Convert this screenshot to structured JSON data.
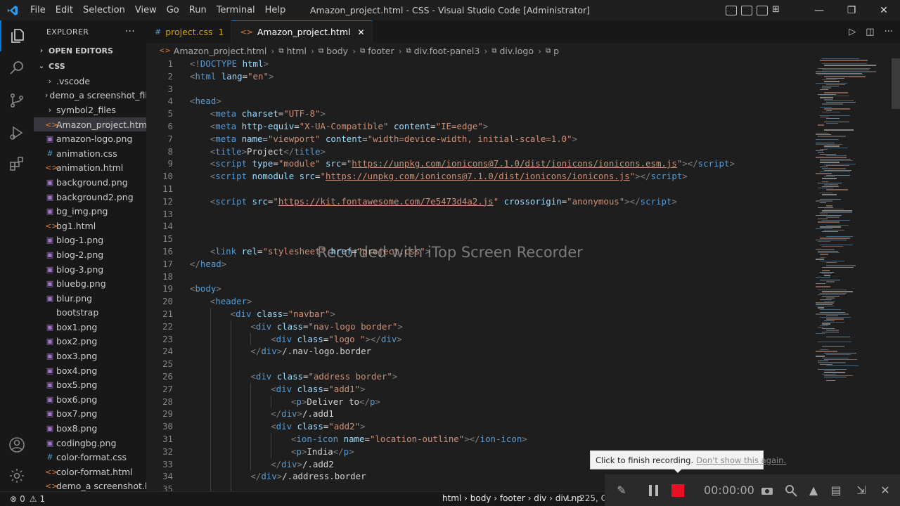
{
  "titlebar": {
    "menu": [
      "File",
      "Edit",
      "Selection",
      "View",
      "Go",
      "Run",
      "Terminal",
      "Help"
    ],
    "title": "Amazon_project.html - CSS - Visual Studio Code [Administrator]"
  },
  "sidebar": {
    "header": "EXPLORER",
    "more": "···",
    "open_editors": "OPEN EDITORS",
    "folder": "CSS",
    "items": [
      {
        "label": ".vscode",
        "kind": "folder"
      },
      {
        "label": "demo_a screenshot_fil...",
        "kind": "folder"
      },
      {
        "label": "symbol2_files",
        "kind": "folder"
      },
      {
        "label": "Amazon_project.html",
        "kind": "html"
      },
      {
        "label": "amazon-logo.png",
        "kind": "image"
      },
      {
        "label": "animation.css",
        "kind": "css"
      },
      {
        "label": "animation.html",
        "kind": "html"
      },
      {
        "label": "background.png",
        "kind": "image"
      },
      {
        "label": "background2.png",
        "kind": "image"
      },
      {
        "label": "bg_img.png",
        "kind": "image"
      },
      {
        "label": "bg1.html",
        "kind": "html"
      },
      {
        "label": "blog-1.png",
        "kind": "image"
      },
      {
        "label": "blog-2.png",
        "kind": "image"
      },
      {
        "label": "blog-3.png",
        "kind": "image"
      },
      {
        "label": "bluebg.png",
        "kind": "image"
      },
      {
        "label": "blur.png",
        "kind": "image"
      },
      {
        "label": "bootstrap",
        "kind": "file"
      },
      {
        "label": "box1.png",
        "kind": "image"
      },
      {
        "label": "box2.png",
        "kind": "image"
      },
      {
        "label": "box3.png",
        "kind": "image"
      },
      {
        "label": "box4.png",
        "kind": "image"
      },
      {
        "label": "box5.png",
        "kind": "image"
      },
      {
        "label": "box6.png",
        "kind": "image"
      },
      {
        "label": "box7.png",
        "kind": "image"
      },
      {
        "label": "box8.png",
        "kind": "image"
      },
      {
        "label": "codingbg.png",
        "kind": "image"
      },
      {
        "label": "color-format.css",
        "kind": "css"
      },
      {
        "label": "color-format.html",
        "kind": "html"
      },
      {
        "label": "demo_a screenshot.ht...",
        "kind": "html"
      }
    ]
  },
  "tabs": [
    {
      "label": "project.css",
      "badge": "1",
      "kind": "css"
    },
    {
      "label": "Amazon_project.html",
      "kind": "html",
      "close": "✕"
    }
  ],
  "breadcrumb": [
    "Amazon_project.html",
    "html",
    "body",
    "footer",
    "div.foot-panel3",
    "div.logo",
    "p"
  ],
  "editor": {
    "lines": [
      {
        "n": "1",
        "i": 0,
        "t": [
          [
            "br",
            "<!"
          ],
          [
            "tag",
            "DOCTYPE"
          ],
          [
            "txt",
            " "
          ],
          [
            "attr",
            "html"
          ],
          [
            "br",
            ">"
          ]
        ]
      },
      {
        "n": "2",
        "i": 0,
        "t": [
          [
            "br",
            "<"
          ],
          [
            "tag",
            "html"
          ],
          [
            "txt",
            " "
          ],
          [
            "attr",
            "lang"
          ],
          [
            "txt",
            "="
          ],
          [
            "str",
            "\"en\""
          ],
          [
            "br",
            ">"
          ]
        ]
      },
      {
        "n": "3",
        "i": 0,
        "t": []
      },
      {
        "n": "4",
        "i": 0,
        "t": [
          [
            "br",
            "<"
          ],
          [
            "tag",
            "head"
          ],
          [
            "br",
            ">"
          ]
        ]
      },
      {
        "n": "5",
        "i": 1,
        "t": [
          [
            "br",
            "<"
          ],
          [
            "tag",
            "meta"
          ],
          [
            "txt",
            " "
          ],
          [
            "attr",
            "charset"
          ],
          [
            "txt",
            "="
          ],
          [
            "str",
            "\"UTF-8\""
          ],
          [
            "br",
            ">"
          ]
        ]
      },
      {
        "n": "6",
        "i": 1,
        "t": [
          [
            "br",
            "<"
          ],
          [
            "tag",
            "meta"
          ],
          [
            "txt",
            " "
          ],
          [
            "attr",
            "http-equiv"
          ],
          [
            "txt",
            "="
          ],
          [
            "str",
            "\"X-UA-Compatible\""
          ],
          [
            "txt",
            " "
          ],
          [
            "attr",
            "content"
          ],
          [
            "txt",
            "="
          ],
          [
            "str",
            "\"IE=edge\""
          ],
          [
            "br",
            ">"
          ]
        ]
      },
      {
        "n": "7",
        "i": 1,
        "t": [
          [
            "br",
            "<"
          ],
          [
            "tag",
            "meta"
          ],
          [
            "txt",
            " "
          ],
          [
            "attr",
            "name"
          ],
          [
            "txt",
            "="
          ],
          [
            "str",
            "\"viewport\""
          ],
          [
            "txt",
            " "
          ],
          [
            "attr",
            "content"
          ],
          [
            "txt",
            "="
          ],
          [
            "str",
            "\"width=device-width, initial-scale=1.0\""
          ],
          [
            "br",
            ">"
          ]
        ]
      },
      {
        "n": "8",
        "i": 1,
        "t": [
          [
            "br",
            "<"
          ],
          [
            "tag",
            "title"
          ],
          [
            "br",
            ">"
          ],
          [
            "txt",
            "Project"
          ],
          [
            "br",
            "</"
          ],
          [
            "tag",
            "title"
          ],
          [
            "br",
            ">"
          ]
        ]
      },
      {
        "n": "9",
        "i": 1,
        "t": [
          [
            "br",
            "<"
          ],
          [
            "tag",
            "script"
          ],
          [
            "txt",
            " "
          ],
          [
            "attr",
            "type"
          ],
          [
            "txt",
            "="
          ],
          [
            "str",
            "\"module\""
          ],
          [
            "txt",
            " "
          ],
          [
            "attr",
            "src"
          ],
          [
            "txt",
            "="
          ],
          [
            "str",
            "\""
          ],
          [
            "url",
            "https://unpkg.com/ionicons@7.1.0/dist/ionicons/ionicons.esm.js"
          ],
          [
            "str",
            "\""
          ],
          [
            "br",
            ">"
          ],
          [
            "br",
            "</"
          ],
          [
            "tag",
            "script"
          ],
          [
            "br",
            ">"
          ]
        ]
      },
      {
        "n": "10",
        "i": 1,
        "t": [
          [
            "br",
            "<"
          ],
          [
            "tag",
            "script"
          ],
          [
            "txt",
            " "
          ],
          [
            "attr",
            "nomodule"
          ],
          [
            "txt",
            " "
          ],
          [
            "attr",
            "src"
          ],
          [
            "txt",
            "="
          ],
          [
            "str",
            "\""
          ],
          [
            "url",
            "https://unpkg.com/ionicons@7.1.0/dist/ionicons/ionicons.js"
          ],
          [
            "str",
            "\""
          ],
          [
            "br",
            ">"
          ],
          [
            "br",
            "</"
          ],
          [
            "tag",
            "script"
          ],
          [
            "br",
            ">"
          ]
        ]
      },
      {
        "n": "11",
        "i": 1,
        "t": []
      },
      {
        "n": "12",
        "i": 1,
        "t": [
          [
            "br",
            "<"
          ],
          [
            "tag",
            "script"
          ],
          [
            "txt",
            " "
          ],
          [
            "attr",
            "src"
          ],
          [
            "txt",
            "="
          ],
          [
            "str",
            "\""
          ],
          [
            "url",
            "https://kit.fontawesome.com/7e5473d4a2.js"
          ],
          [
            "str",
            "\""
          ],
          [
            "txt",
            " "
          ],
          [
            "attr",
            "crossorigin"
          ],
          [
            "txt",
            "="
          ],
          [
            "str",
            "\"anonymous\""
          ],
          [
            "br",
            ">"
          ],
          [
            "br",
            "</"
          ],
          [
            "tag",
            "script"
          ],
          [
            "br",
            ">"
          ]
        ]
      },
      {
        "n": "13",
        "i": 1,
        "t": []
      },
      {
        "n": "14",
        "i": 1,
        "t": []
      },
      {
        "n": "15",
        "i": 1,
        "t": []
      },
      {
        "n": "16",
        "i": 1,
        "t": [
          [
            "br",
            "<"
          ],
          [
            "tag",
            "link"
          ],
          [
            "txt",
            " "
          ],
          [
            "attr",
            "rel"
          ],
          [
            "txt",
            "="
          ],
          [
            "str",
            "\"stylesheet\""
          ],
          [
            "txt",
            " "
          ],
          [
            "attr",
            "href"
          ],
          [
            "txt",
            "="
          ],
          [
            "str",
            "\"project.css\""
          ],
          [
            "br",
            ">"
          ]
        ]
      },
      {
        "n": "17",
        "i": 0,
        "t": [
          [
            "br",
            "</"
          ],
          [
            "tag",
            "head"
          ],
          [
            "br",
            ">"
          ]
        ]
      },
      {
        "n": "18",
        "i": 0,
        "t": []
      },
      {
        "n": "19",
        "i": 0,
        "t": [
          [
            "br",
            "<"
          ],
          [
            "tag",
            "body"
          ],
          [
            "br",
            ">"
          ]
        ]
      },
      {
        "n": "20",
        "i": 1,
        "t": [
          [
            "br",
            "<"
          ],
          [
            "tag",
            "header"
          ],
          [
            "br",
            ">"
          ]
        ]
      },
      {
        "n": "21",
        "i": 2,
        "t": [
          [
            "br",
            "<"
          ],
          [
            "tag",
            "div"
          ],
          [
            "txt",
            " "
          ],
          [
            "attr",
            "class"
          ],
          [
            "txt",
            "="
          ],
          [
            "str",
            "\"navbar\""
          ],
          [
            "br",
            ">"
          ]
        ]
      },
      {
        "n": "22",
        "i": 3,
        "t": [
          [
            "br",
            "<"
          ],
          [
            "tag",
            "div"
          ],
          [
            "txt",
            " "
          ],
          [
            "attr",
            "class"
          ],
          [
            "txt",
            "="
          ],
          [
            "str",
            "\"nav-logo border\""
          ],
          [
            "br",
            ">"
          ]
        ]
      },
      {
        "n": "23",
        "i": 4,
        "t": [
          [
            "br",
            "<"
          ],
          [
            "tag",
            "div"
          ],
          [
            "txt",
            " "
          ],
          [
            "attr",
            "class"
          ],
          [
            "txt",
            "="
          ],
          [
            "str",
            "\"logo \""
          ],
          [
            "br",
            "></"
          ],
          [
            "tag",
            "div"
          ],
          [
            "br",
            ">"
          ]
        ]
      },
      {
        "n": "24",
        "i": 3,
        "t": [
          [
            "br",
            "</"
          ],
          [
            "tag",
            "div"
          ],
          [
            "br",
            ">"
          ],
          [
            "txt",
            "/.nav-logo.border"
          ]
        ]
      },
      {
        "n": "25",
        "i": 3,
        "t": []
      },
      {
        "n": "26",
        "i": 3,
        "t": [
          [
            "br",
            "<"
          ],
          [
            "tag",
            "div"
          ],
          [
            "txt",
            " "
          ],
          [
            "attr",
            "class"
          ],
          [
            "txt",
            "="
          ],
          [
            "str",
            "\"address border\""
          ],
          [
            "br",
            ">"
          ]
        ]
      },
      {
        "n": "27",
        "i": 4,
        "t": [
          [
            "br",
            "<"
          ],
          [
            "tag",
            "div"
          ],
          [
            "txt",
            " "
          ],
          [
            "attr",
            "class"
          ],
          [
            "txt",
            "="
          ],
          [
            "str",
            "\"add1\""
          ],
          [
            "br",
            ">"
          ]
        ]
      },
      {
        "n": "28",
        "i": 5,
        "t": [
          [
            "br",
            "<"
          ],
          [
            "tag",
            "p"
          ],
          [
            "br",
            ">"
          ],
          [
            "txt",
            "Deliver to"
          ],
          [
            "br",
            "</"
          ],
          [
            "tag",
            "p"
          ],
          [
            "br",
            ">"
          ]
        ]
      },
      {
        "n": "29",
        "i": 4,
        "t": [
          [
            "br",
            "</"
          ],
          [
            "tag",
            "div"
          ],
          [
            "br",
            ">"
          ],
          [
            "txt",
            "/.add1"
          ]
        ]
      },
      {
        "n": "30",
        "i": 4,
        "t": [
          [
            "br",
            "<"
          ],
          [
            "tag",
            "div"
          ],
          [
            "txt",
            " "
          ],
          [
            "attr",
            "class"
          ],
          [
            "txt",
            "="
          ],
          [
            "str",
            "\"add2\""
          ],
          [
            "br",
            ">"
          ]
        ]
      },
      {
        "n": "31",
        "i": 5,
        "t": [
          [
            "br",
            "<"
          ],
          [
            "tag",
            "ion-icon"
          ],
          [
            "txt",
            " "
          ],
          [
            "attr",
            "name"
          ],
          [
            "txt",
            "="
          ],
          [
            "str",
            "\"location-outline\""
          ],
          [
            "br",
            "></"
          ],
          [
            "tag",
            "ion-icon"
          ],
          [
            "br",
            ">"
          ]
        ]
      },
      {
        "n": "32",
        "i": 5,
        "t": [
          [
            "br",
            "<"
          ],
          [
            "tag",
            "p"
          ],
          [
            "br",
            ">"
          ],
          [
            "txt",
            "India"
          ],
          [
            "br",
            "</"
          ],
          [
            "tag",
            "p"
          ],
          [
            "br",
            ">"
          ]
        ]
      },
      {
        "n": "33",
        "i": 4,
        "t": [
          [
            "br",
            "</"
          ],
          [
            "tag",
            "div"
          ],
          [
            "br",
            ">"
          ],
          [
            "txt",
            "/.add2"
          ]
        ]
      },
      {
        "n": "34",
        "i": 3,
        "t": [
          [
            "br",
            "</"
          ],
          [
            "tag",
            "div"
          ],
          [
            "br",
            ">"
          ],
          [
            "txt",
            "/.address.border"
          ]
        ]
      },
      {
        "n": "35",
        "i": 3,
        "t": []
      }
    ]
  },
  "watermark": "Recorded with iTop Screen Recorder",
  "statusbar": {
    "errors": "0",
    "warnings": "1",
    "crumb": "html › body › footer › div › div › p",
    "position": "Ln 225, Col"
  },
  "recorder": {
    "tooltip_text": "Click to finish recording.",
    "tooltip_link": "Don't show this again.",
    "timer": "00:00:00"
  },
  "colors": {
    "accent": "#0078d4",
    "record": "#e81123",
    "html_icon": "#e37933",
    "css_icon": "#519aba",
    "image_icon": "#a074c4"
  }
}
